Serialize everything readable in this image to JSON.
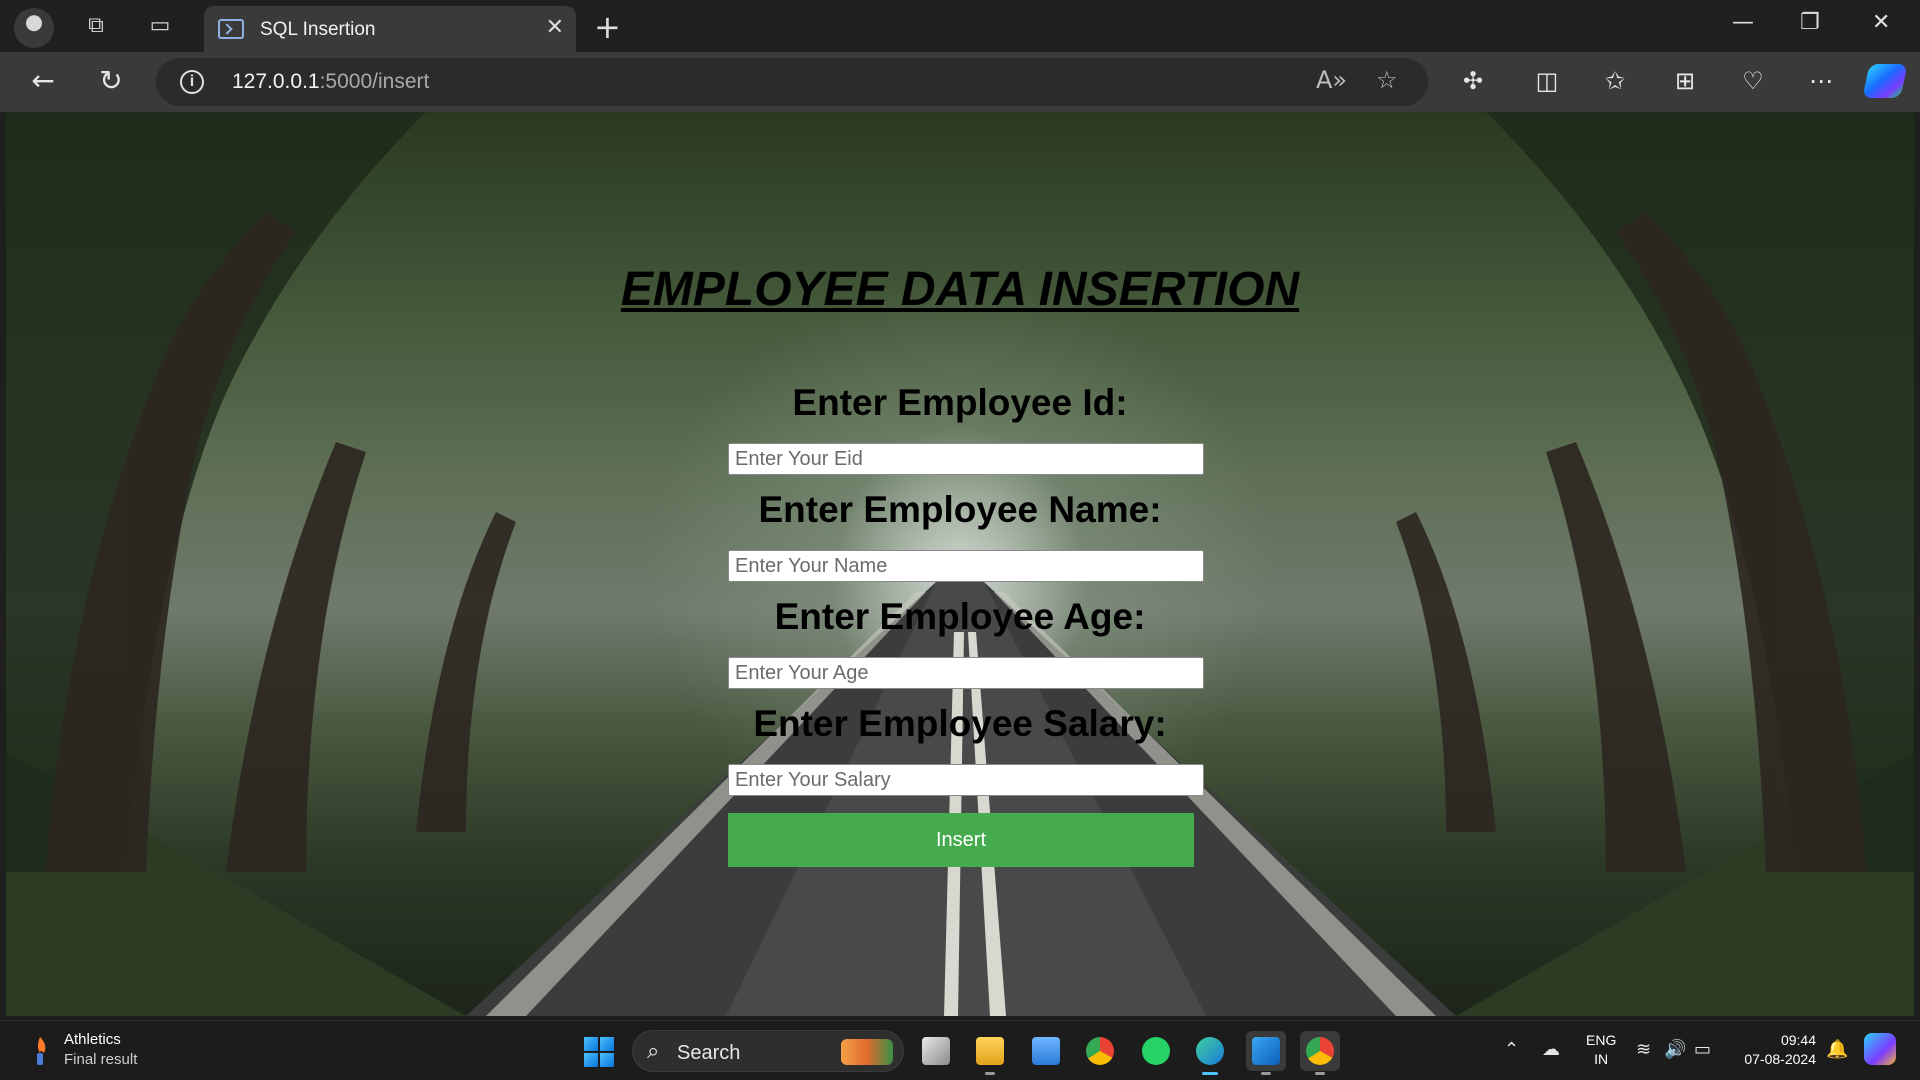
{
  "browser": {
    "tab_title": "SQL Insertion",
    "tab_close": "✕",
    "new_tab": "+",
    "url_host": "127.0.0.1",
    "url_rest": ":5000/insert",
    "icons": [
      "profile-avatar",
      "workspaces-icon",
      "tab-actions-icon",
      "back-icon",
      "refresh-icon",
      "info-icon",
      "read-aloud-icon",
      "favorite-star-icon",
      "extensions-icon",
      "split-screen-icon",
      "favorites-icon",
      "collections-icon",
      "browser-essentials-icon",
      "more-icon",
      "copilot-icon"
    ],
    "window_controls": {
      "minimize": "—",
      "restore": "❐",
      "close": "✕"
    }
  },
  "page": {
    "title": "EMPLOYEE DATA INSERTION",
    "fields": [
      {
        "label": "Enter Employee Id:",
        "placeholder": "Enter Your Eid"
      },
      {
        "label": "Enter Employee Name:",
        "placeholder": "Enter Your Name"
      },
      {
        "label": "Enter Employee Age:",
        "placeholder": "Enter Your Age"
      },
      {
        "label": "Enter Employee Salary:",
        "placeholder": "Enter Your Salary"
      }
    ],
    "submit_label": "Insert",
    "accent_color": "#46ab4f"
  },
  "taskbar": {
    "news_title": "Athletics",
    "news_subtitle": "Final result",
    "search_label": "Search",
    "apps": [
      "task-view",
      "file-explorer",
      "notepad",
      "chrome",
      "whatsapp",
      "edge",
      "vscode",
      "chrome-profile"
    ],
    "language_line1": "ENG",
    "language_line2": "IN",
    "time": "09:44",
    "date": "07-08-2024"
  }
}
